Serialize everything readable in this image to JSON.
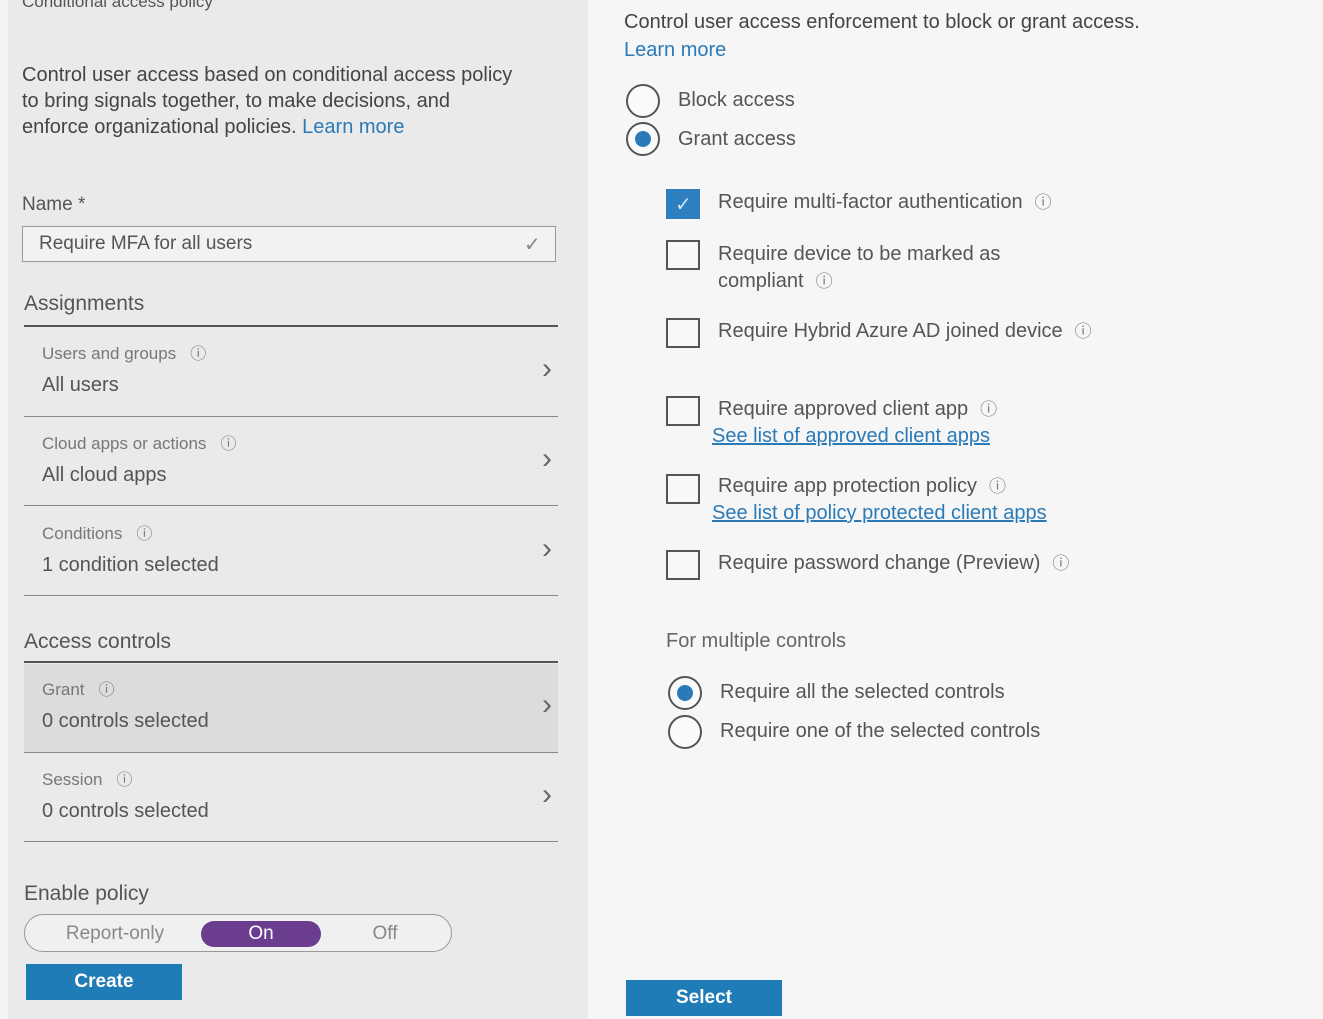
{
  "left": {
    "top_cut_title": "Conditional access policy",
    "description": "Control user access based on conditional access policy to bring signals together, to make decisions, and enforce organizational policies.",
    "learn_more": "Learn more",
    "name_label": "Name *",
    "name_value": "Require MFA for all users",
    "assignments_heading": "Assignments",
    "assignments": [
      {
        "title": "Users and groups",
        "value": "All users"
      },
      {
        "title": "Cloud apps or actions",
        "value": "All cloud apps"
      },
      {
        "title": "Conditions",
        "value": "1 condition selected"
      }
    ],
    "access_controls_heading": "Access controls",
    "access_controls": [
      {
        "title": "Grant",
        "value": "0 controls selected"
      },
      {
        "title": "Session",
        "value": "0 controls selected"
      }
    ],
    "enable_policy_heading": "Enable policy",
    "toggle": {
      "report_only": "Report-only",
      "on": "On",
      "off": "Off",
      "selected": "On"
    },
    "create_button": "Create"
  },
  "right": {
    "description": "Control user access enforcement to block or grant access.",
    "learn_more": "Learn more",
    "block_access": "Block access",
    "grant_access": "Grant access",
    "grant_selected": true,
    "controls": [
      {
        "label": "Require multi-factor authentication",
        "checked": true
      },
      {
        "label": "Require device to be marked as compliant",
        "checked": false
      },
      {
        "label": "Require Hybrid Azure AD joined device",
        "checked": false
      },
      {
        "label": "Require approved client app",
        "checked": false,
        "link": "See list of approved client apps"
      },
      {
        "label": "Require app protection policy",
        "checked": false,
        "link": "See list of policy protected client apps"
      },
      {
        "label": "Require password change (Preview)",
        "checked": false
      }
    ],
    "multiple_heading": "For multiple controls",
    "require_all": "Require all the selected controls",
    "require_one": "Require one of the selected controls",
    "multiple_selected": "all",
    "select_button": "Select"
  },
  "colors": {
    "accent": "#1f7cb6",
    "link": "#2a7ab8",
    "toggle_on": "#6b3d8f"
  },
  "icons": {
    "info": "info-icon",
    "chevron": "chevron-right-icon",
    "check": "checkmark-icon"
  }
}
